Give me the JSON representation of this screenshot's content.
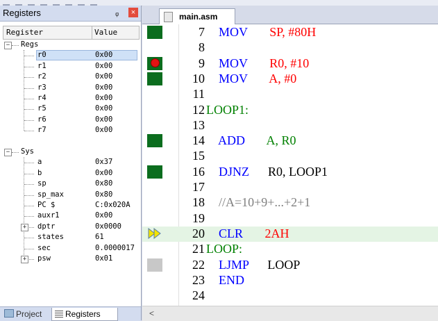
{
  "panel": {
    "title": "Registers",
    "pin": "ᵩ",
    "close": "×",
    "col_register": "Register",
    "col_value": "Value"
  },
  "regs": {
    "label": "Regs",
    "items": [
      {
        "name": "r0",
        "value": "0x00"
      },
      {
        "name": "r1",
        "value": "0x00"
      },
      {
        "name": "r2",
        "value": "0x00"
      },
      {
        "name": "r3",
        "value": "0x00"
      },
      {
        "name": "r4",
        "value": "0x00"
      },
      {
        "name": "r5",
        "value": "0x00"
      },
      {
        "name": "r6",
        "value": "0x00"
      },
      {
        "name": "r7",
        "value": "0x00"
      }
    ]
  },
  "sys": {
    "label": "Sys",
    "items": [
      {
        "name": "a",
        "value": "0x37"
      },
      {
        "name": "b",
        "value": "0x00"
      },
      {
        "name": "sp",
        "value": "0x80"
      },
      {
        "name": "sp_max",
        "value": "0x80"
      },
      {
        "name": "PC  $",
        "value": "C:0x020A"
      },
      {
        "name": "auxr1",
        "value": "0x00"
      },
      {
        "name": "dptr",
        "value": "0x0000"
      },
      {
        "name": "states",
        "value": "61"
      },
      {
        "name": "sec",
        "value": "0.0000017"
      },
      {
        "name": "psw",
        "value": "0x01"
      }
    ]
  },
  "bottom_tabs": {
    "project": "Project",
    "registers": "Registers"
  },
  "editor": {
    "tab": "main.asm",
    "lines": [
      {
        "num": "7",
        "mark": "green",
        "parts": [
          [
            "    ",
            "bl"
          ],
          [
            "MOV",
            "kw"
          ],
          [
            "       ",
            "bl"
          ],
          [
            "SP, #80H",
            "num"
          ]
        ]
      },
      {
        "num": "8",
        "mark": "",
        "parts": []
      },
      {
        "num": "9",
        "mark": "bp",
        "parts": [
          [
            "    ",
            "bl"
          ],
          [
            "MOV",
            "kw"
          ],
          [
            "       ",
            "bl"
          ],
          [
            "R0, #10",
            "num"
          ]
        ]
      },
      {
        "num": "10",
        "mark": "green",
        "parts": [
          [
            "    ",
            "bl"
          ],
          [
            "MOV",
            "kw"
          ],
          [
            "       ",
            "bl"
          ],
          [
            "A, #0",
            "num"
          ]
        ]
      },
      {
        "num": "11",
        "mark": "",
        "parts": []
      },
      {
        "num": "12",
        "mark": "",
        "parts": [
          [
            "LOOP1:",
            "lbl2"
          ]
        ]
      },
      {
        "num": "13",
        "mark": "",
        "parts": []
      },
      {
        "num": "14",
        "mark": "green",
        "parts": [
          [
            "    ",
            "bl"
          ],
          [
            "ADD",
            "kw"
          ],
          [
            "       ",
            "bl"
          ],
          [
            "A, R0",
            "lbl2"
          ]
        ]
      },
      {
        "num": "15",
        "mark": "",
        "parts": []
      },
      {
        "num": "16",
        "mark": "green",
        "parts": [
          [
            "    ",
            "bl"
          ],
          [
            "DJNZ",
            "kw"
          ],
          [
            "      ",
            "bl"
          ],
          [
            "R0, LOOP1",
            "bl"
          ]
        ]
      },
      {
        "num": "17",
        "mark": "",
        "parts": []
      },
      {
        "num": "18",
        "mark": "",
        "parts": [
          [
            "    ",
            "bl"
          ],
          [
            "//A=10+9+...+2+1",
            "cm"
          ]
        ]
      },
      {
        "num": "19",
        "mark": "",
        "parts": []
      },
      {
        "num": "20",
        "mark": "arrow",
        "parts": [
          [
            "    ",
            "bl"
          ],
          [
            "CLR",
            "kw"
          ],
          [
            "       ",
            "bl"
          ],
          [
            "2AH",
            "num"
          ]
        ]
      },
      {
        "num": "21",
        "mark": "",
        "parts": [
          [
            "LOOP:",
            "lbl2"
          ]
        ]
      },
      {
        "num": "22",
        "mark": "gray",
        "parts": [
          [
            "    ",
            "bl"
          ],
          [
            "LJMP",
            "kw"
          ],
          [
            "      ",
            "bl"
          ],
          [
            "LOOP",
            "bl"
          ]
        ]
      },
      {
        "num": "23",
        "mark": "",
        "parts": [
          [
            "    ",
            "bl"
          ],
          [
            "END",
            "kw"
          ]
        ]
      },
      {
        "num": "24",
        "mark": "",
        "parts": []
      }
    ]
  }
}
